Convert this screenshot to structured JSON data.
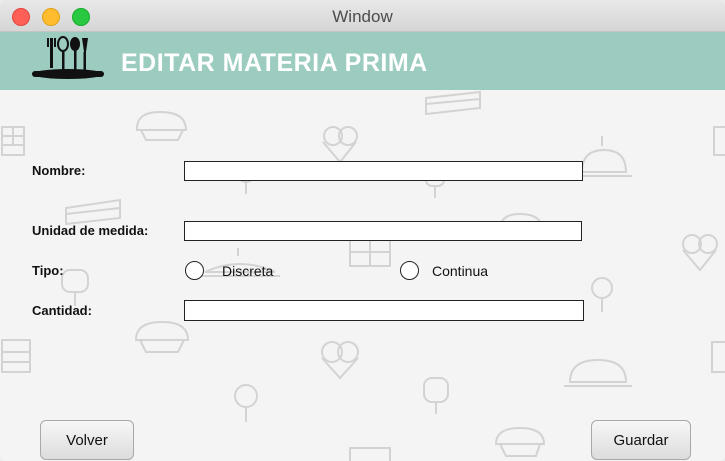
{
  "window": {
    "title": "Window"
  },
  "banner": {
    "title": "EDITAR MATERIA PRIMA",
    "color": "#9ccbbf"
  },
  "form": {
    "nombre": {
      "label": "Nombre:",
      "value": ""
    },
    "unidad": {
      "label": "Unidad de medida:",
      "value": ""
    },
    "tipo": {
      "label": "Tipo:",
      "options": [
        "Discreta",
        "Continua"
      ],
      "selected": null
    },
    "cantidad": {
      "label": "Cantidad:",
      "value": ""
    }
  },
  "buttons": {
    "back": "Volver",
    "save": "Guardar"
  },
  "decor_icons": [
    "cake-slice-icon",
    "cupcake-icon",
    "ice-cream-icon",
    "chocolate-bar-icon",
    "lollipop-icon",
    "popsicle-icon",
    "jelly-mold-icon",
    "layer-cake-icon"
  ]
}
